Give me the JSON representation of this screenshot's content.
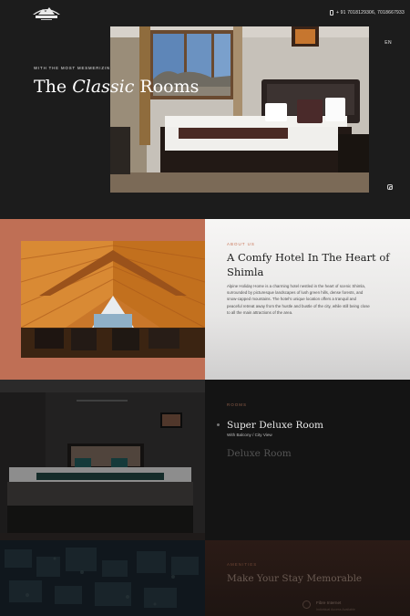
{
  "header": {
    "logo_alt": "Alpine Holiday Home",
    "phone": "+ 91 7018129306, 7018667933",
    "language": "EN"
  },
  "hero": {
    "kicker": "WITH THE MOST MESMERIZING VIEW",
    "title_part1": "The",
    "title_italic": "Classic",
    "title_part2": "Rooms"
  },
  "about": {
    "kicker": "ABOUT US",
    "title": "A Comfy Hotel In The Heart of Shimla",
    "text": "Alpine Holiday Home is a charming hotel nestled in the heart of scenic Shimla, surrounded by picturesque landscapes of lush green hills, dense forests, and snow-capped mountains. The hotel's unique location offers a tranquil and peaceful retreat away from the hustle and bustle of the city, while still being close to all the main attractions of the area."
  },
  "rooms": {
    "kicker": "ROOMS",
    "items": [
      {
        "name": "Super Deluxe Room",
        "subtitle": "With Balcony / City View"
      },
      {
        "name": "Deluxe Room"
      }
    ]
  },
  "amenities": {
    "kicker": "AMENITIES",
    "title": "Make Your Stay Memorable",
    "item_title": "Fibre Internet",
    "item_sub": "Individual Access Available"
  },
  "colors": {
    "accent": "#c87356",
    "about_bg": "#bf6f55",
    "dark": "#1b1b1b"
  }
}
